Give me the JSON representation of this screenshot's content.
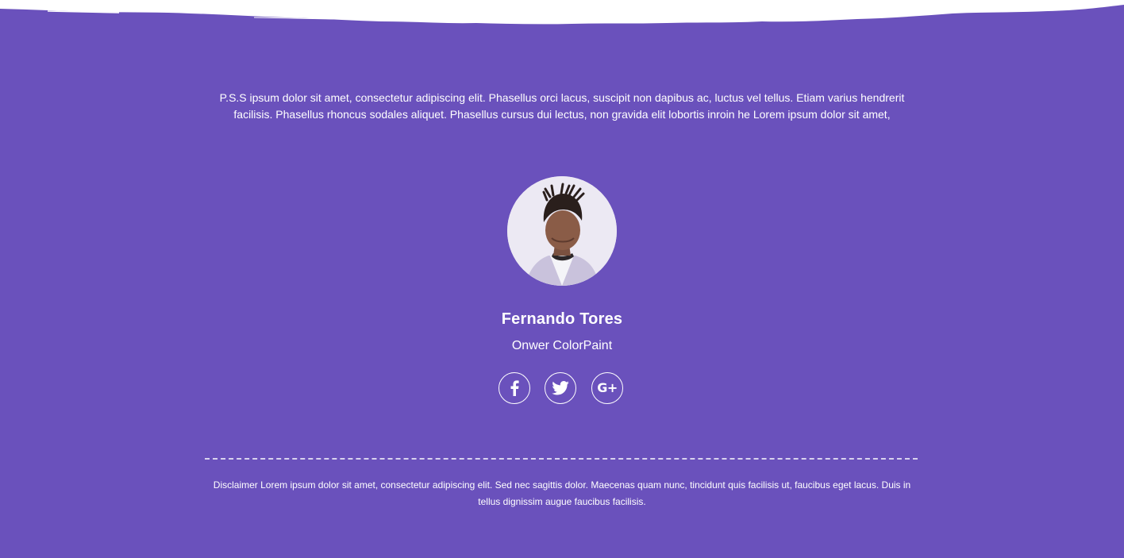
{
  "colors": {
    "background": "#6a51bc",
    "text": "#ffffff",
    "top_edge": "#ffffff"
  },
  "intro": {
    "text": "P.S.S ipsum dolor sit amet, consectetur adipiscing elit. Phasellus orci lacus, suscipit non dapibus ac, luctus vel tellus. Etiam varius hendrerit facilisis. Phasellus rhoncus sodales aliquet. Phasellus cursus dui lectus, non gravida elit lobortis inroin he Lorem ipsum dolor sit amet,"
  },
  "author": {
    "name": "Fernando Tores",
    "role": "Onwer ColorPaint"
  },
  "social": [
    {
      "network": "facebook",
      "icon": "facebook-icon"
    },
    {
      "network": "twitter",
      "icon": "twitter-icon"
    },
    {
      "network": "google-plus",
      "icon": "google-plus-icon",
      "label": "G+"
    }
  ],
  "footer": {
    "disclaimer": "Disclaimer Lorem ipsum dolor sit amet, consectetur adipiscing elit. Sed nec sagittis dolor. Maecenas quam nunc, tincidunt quis facilisis ut, faucibus eget lacus. Duis in tellus dignissim augue faucibus facilisis."
  }
}
